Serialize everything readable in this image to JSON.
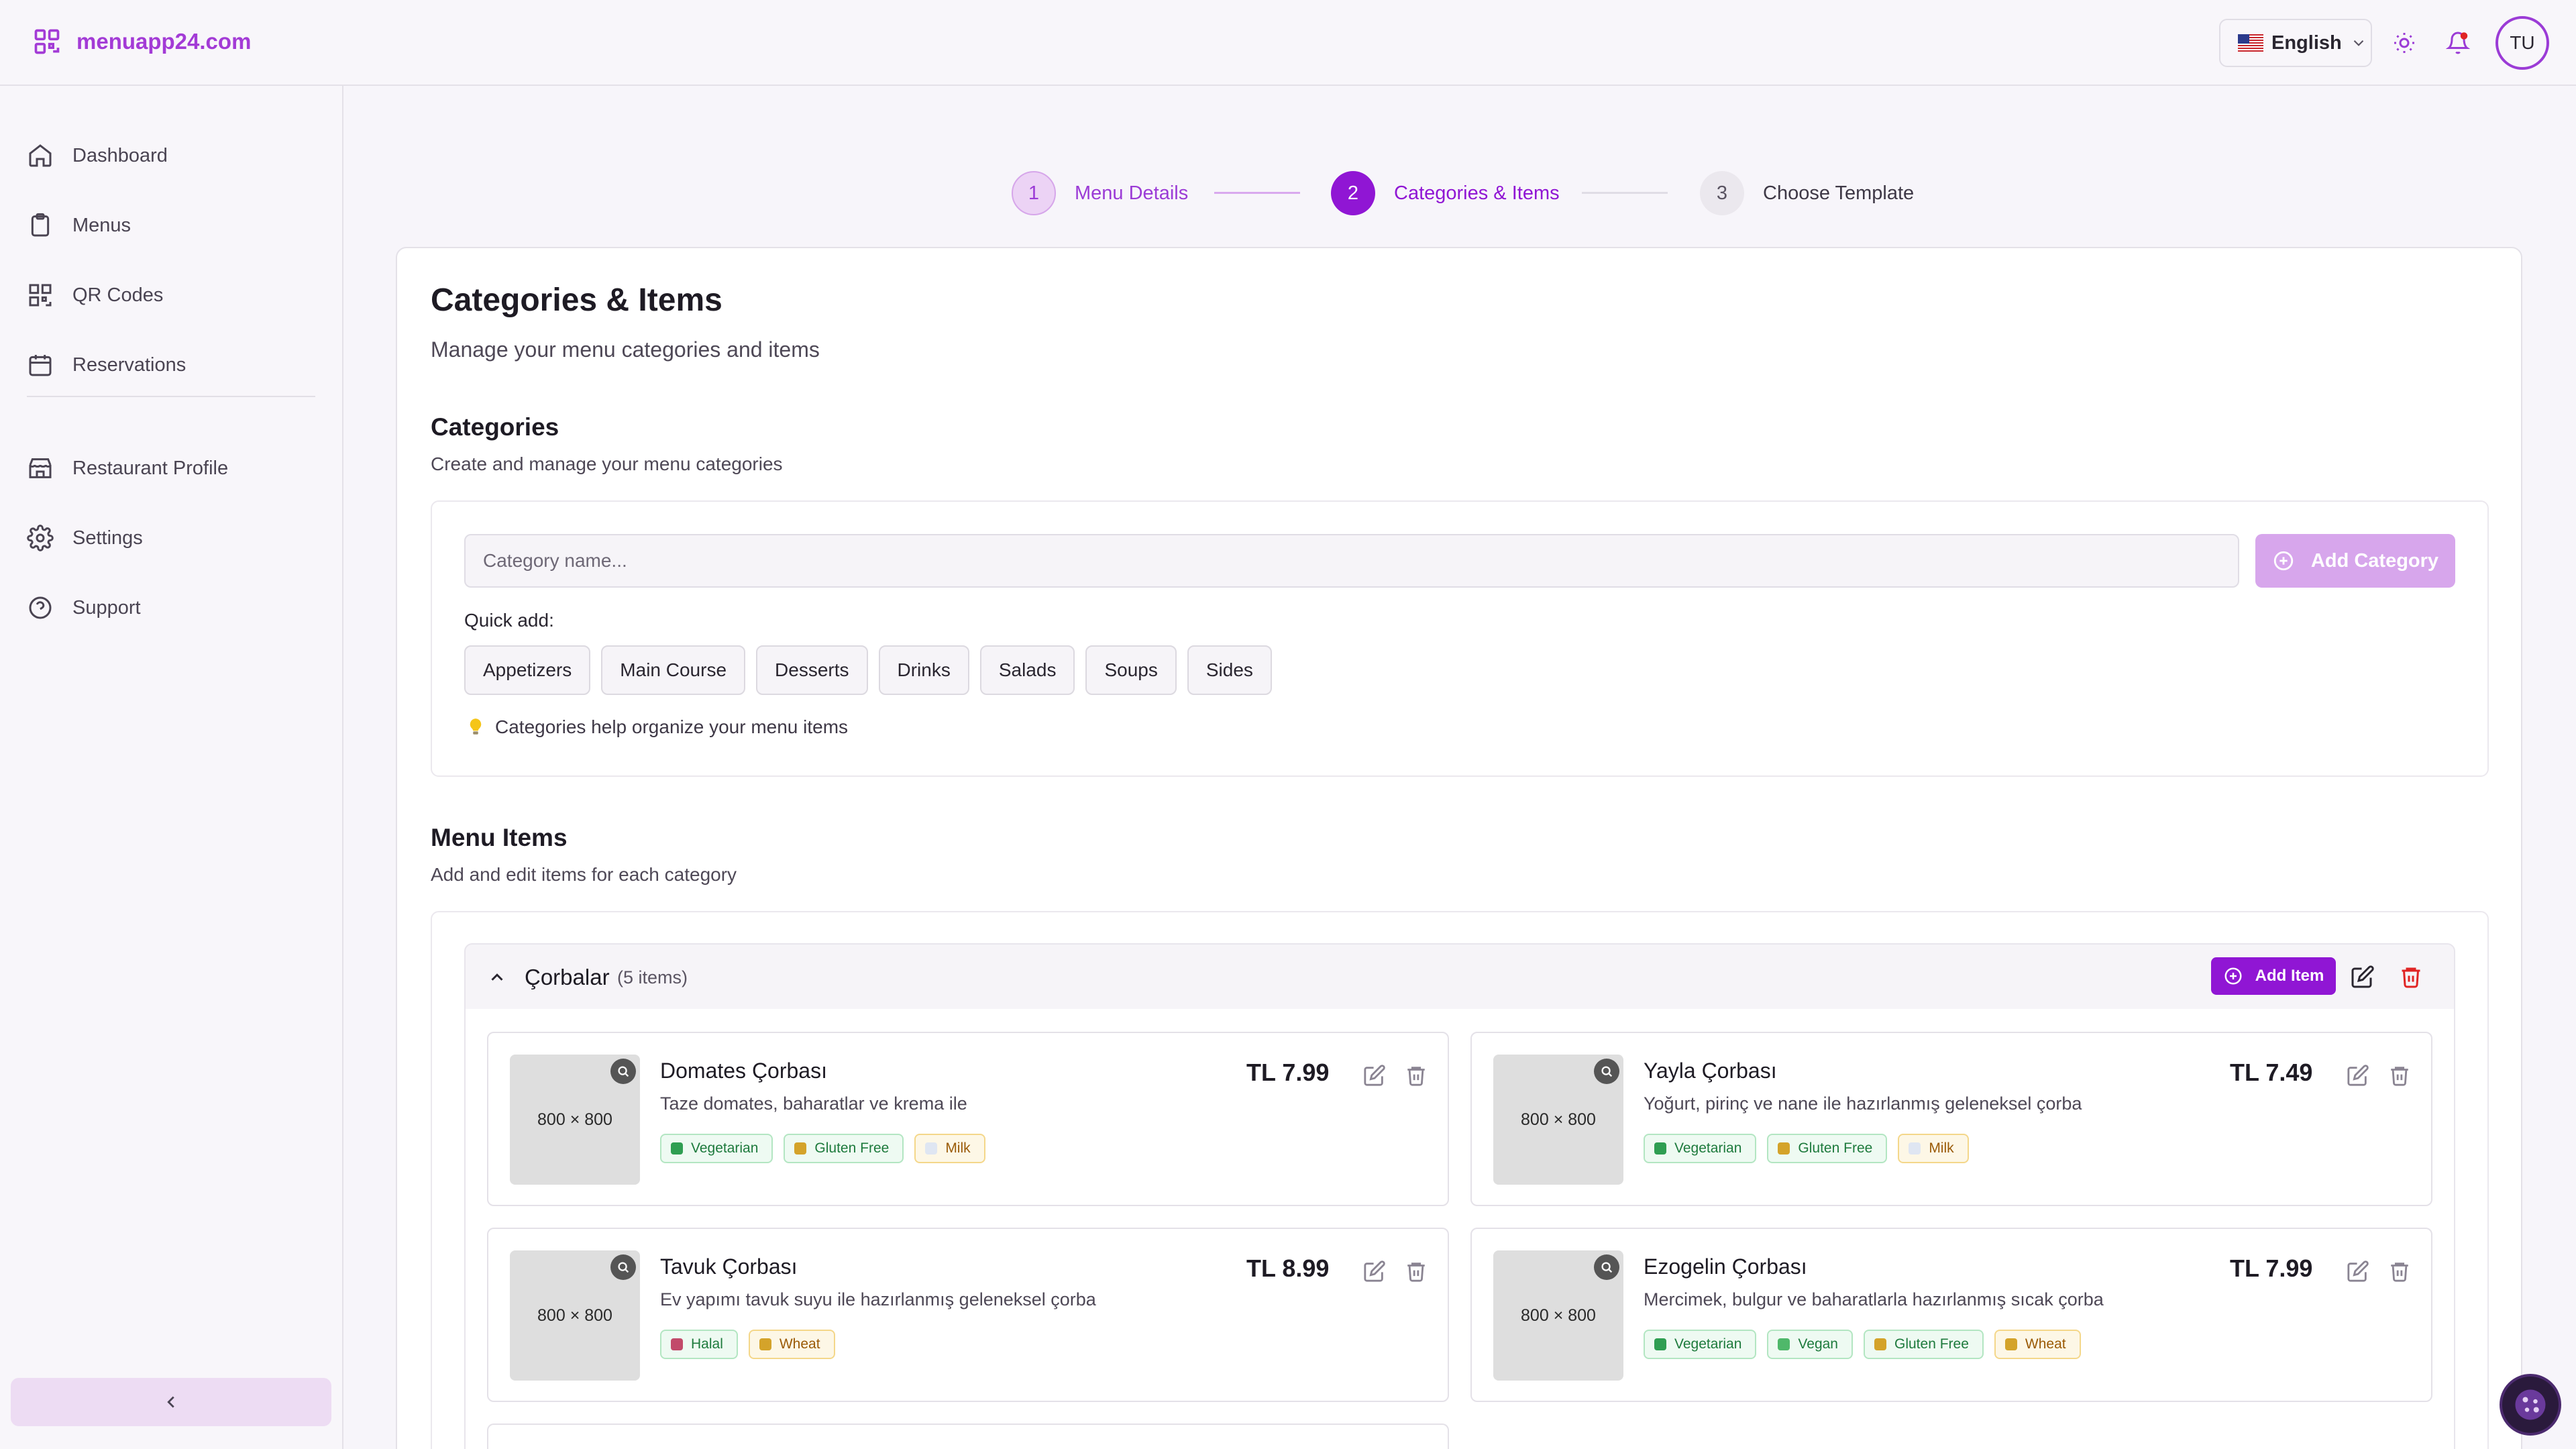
{
  "app": {
    "logo_text": "menuapp24.com"
  },
  "header": {
    "language": "English",
    "user_initials": "TU",
    "colors": {
      "brand": "#a33bd6",
      "accent": "#9016d4"
    },
    "icons": [
      "qr-logo-icon",
      "us-flag-icon",
      "chevron-down-icon",
      "sun-icon",
      "bell-icon"
    ]
  },
  "sidebar": {
    "items": [
      {
        "label": "Dashboard",
        "icon": "home-icon"
      },
      {
        "label": "Menus",
        "icon": "clipboard-icon"
      },
      {
        "label": "QR Codes",
        "icon": "qr-code-icon"
      },
      {
        "label": "Reservations",
        "icon": "calendar-icon"
      },
      {
        "label": "Restaurant Profile",
        "icon": "store-icon"
      },
      {
        "label": "Settings",
        "icon": "gear-icon"
      },
      {
        "label": "Support",
        "icon": "help-circle-icon"
      }
    ]
  },
  "stepper": {
    "steps": [
      {
        "number": "1",
        "label": "Menu Details",
        "state": "done"
      },
      {
        "number": "2",
        "label": "Categories & Items",
        "state": "active"
      },
      {
        "number": "3",
        "label": "Choose Template",
        "state": "pending"
      }
    ]
  },
  "page": {
    "title": "Categories & Items",
    "subtitle": "Manage your menu categories and items"
  },
  "categories": {
    "title": "Categories",
    "subtitle": "Create and manage your menu categories",
    "input_placeholder": "Category name...",
    "add_button": "Add Category",
    "quick_add_label": "Quick add:",
    "quick_add": [
      "Appetizers",
      "Main Course",
      "Desserts",
      "Drinks",
      "Salads",
      "Soups",
      "Sides"
    ],
    "hint": "Categories help organize your menu items"
  },
  "menu_items": {
    "title": "Menu Items",
    "subtitle": "Add and edit items for each category",
    "group": {
      "name": "Çorbalar",
      "count": "(5 items)",
      "add_button": "Add Item",
      "items": [
        {
          "name": "Domates Çorbası",
          "description": "Taze domates, baharatlar ve krema ile",
          "price": "TL 7.99",
          "image_label": "800 × 800",
          "tags": [
            {
              "label": "Vegetarian",
              "tone": "green",
              "icon": "leaf-icon"
            },
            {
              "label": "Gluten Free",
              "tone": "green",
              "icon": "wheat-icon"
            },
            {
              "label": "Milk",
              "tone": "yellow",
              "icon": "milk-icon"
            }
          ]
        },
        {
          "name": "Yayla Çorbası",
          "description": "Yoğurt, pirinç ve nane ile hazırlanmış geleneksel çorba",
          "price": "TL 7.49",
          "image_label": "800 × 800",
          "tags": [
            {
              "label": "Vegetarian",
              "tone": "green",
              "icon": "leaf-icon"
            },
            {
              "label": "Gluten Free",
              "tone": "green",
              "icon": "wheat-icon"
            },
            {
              "label": "Milk",
              "tone": "yellow",
              "icon": "milk-icon"
            }
          ]
        },
        {
          "name": "Tavuk Çorbası",
          "description": "Ev yapımı tavuk suyu ile hazırlanmış geleneksel çorba",
          "price": "TL 8.99",
          "image_label": "800 × 800",
          "tags": [
            {
              "label": "Halal",
              "tone": "green",
              "icon": "halal-icon"
            },
            {
              "label": "Wheat",
              "tone": "yellow",
              "icon": "wheat-icon"
            }
          ]
        },
        {
          "name": "Ezogelin Çorbası",
          "description": "Mercimek, bulgur ve baharatlarla hazırlanmış sıcak çorba",
          "price": "TL 7.99",
          "image_label": "800 × 800",
          "tags": [
            {
              "label": "Vegetarian",
              "tone": "green",
              "icon": "leaf-icon"
            },
            {
              "label": "Vegan",
              "tone": "green",
              "icon": "sprout-icon"
            },
            {
              "label": "Gluten Free",
              "tone": "green",
              "icon": "wheat-icon"
            },
            {
              "label": "Wheat",
              "tone": "yellow",
              "icon": "wheat-icon"
            }
          ]
        }
      ]
    }
  }
}
